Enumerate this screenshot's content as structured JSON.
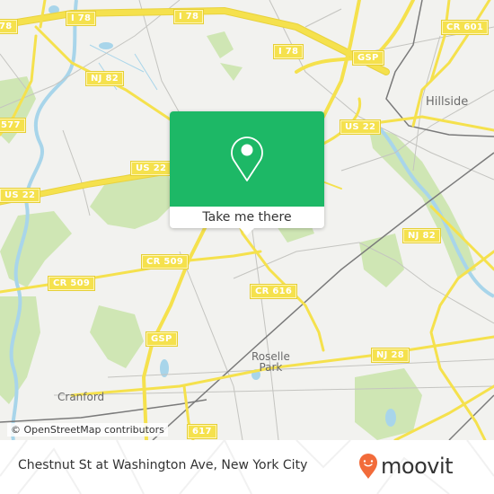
{
  "map": {
    "route_shields": [
      {
        "id": "i78-a",
        "label": "I 78"
      },
      {
        "id": "i78-b",
        "label": "I 78"
      },
      {
        "id": "i78-c",
        "label": "I 78"
      },
      {
        "id": "i78-left",
        "label": "78"
      },
      {
        "id": "cr601",
        "label": "CR 601"
      },
      {
        "id": "gsp-top",
        "label": "GSP"
      },
      {
        "id": "nj82-top",
        "label": "NJ 82"
      },
      {
        "id": "cr577",
        "label": "577"
      },
      {
        "id": "us22-mid",
        "label": "US 22"
      },
      {
        "id": "us22-right",
        "label": "US 22"
      },
      {
        "id": "us22-left",
        "label": "US 22"
      },
      {
        "id": "nj82-right",
        "label": "NJ 82"
      },
      {
        "id": "cr509-a",
        "label": "CR 509"
      },
      {
        "id": "cr509-b",
        "label": "CR 509"
      },
      {
        "id": "cr616",
        "label": "CR 616"
      },
      {
        "id": "gsp-bottom",
        "label": "GSP"
      },
      {
        "id": "nj28",
        "label": "NJ 28"
      },
      {
        "id": "cr617",
        "label": "617"
      }
    ],
    "places": [
      {
        "id": "hillside",
        "label": "Hillside"
      },
      {
        "id": "roselle-park",
        "label": "Roselle\nPark"
      },
      {
        "id": "cranford",
        "label": "Cranford"
      }
    ],
    "attribution": "© OpenStreetMap contributors",
    "colors": {
      "land": "#f2f2ef",
      "road": "#f5e14d",
      "water": "#a8d5ea",
      "park": "#cfe6b4",
      "minor_road": "#bdbdbd",
      "rail": "#777777"
    }
  },
  "popup": {
    "icon": "map-pin-icon",
    "button_label": "Take me there",
    "color": "#1db866"
  },
  "footer": {
    "title": "Chestnut St at Washington Ave, New York City",
    "logo_text": "moovit",
    "logo_color": "#f26b3a"
  }
}
